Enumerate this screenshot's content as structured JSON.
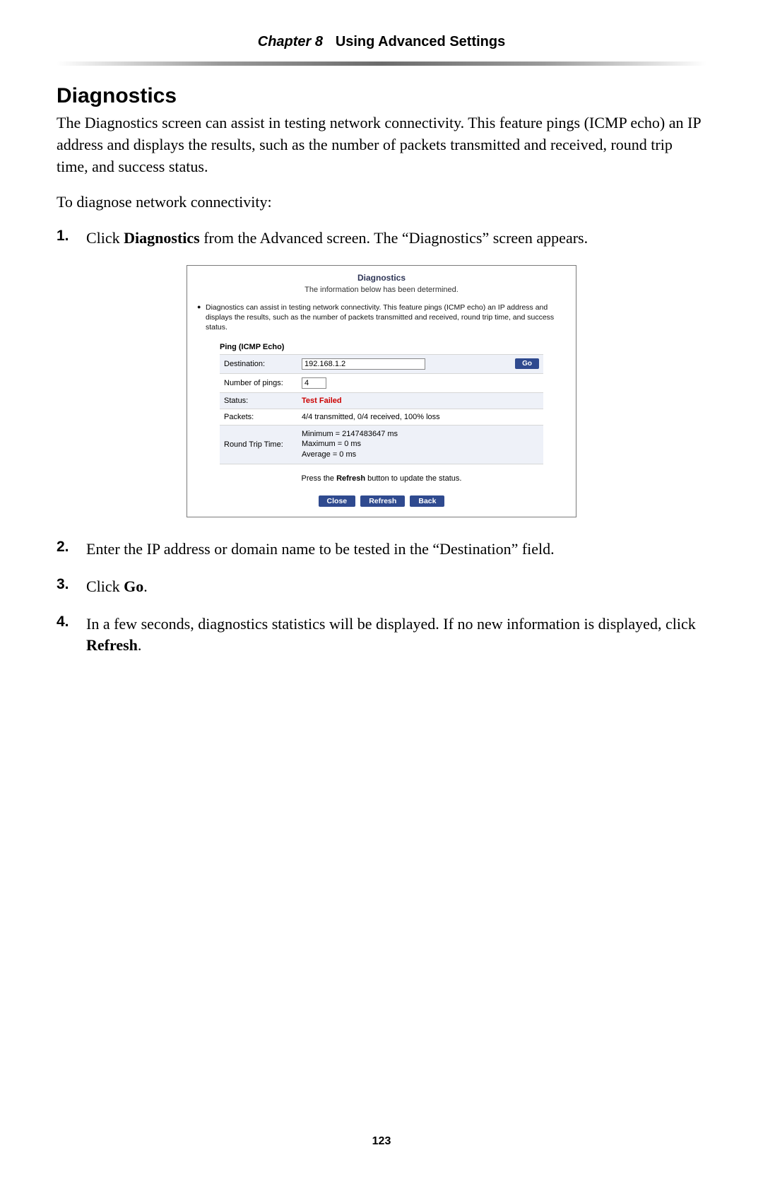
{
  "header": {
    "chapter_label": "Chapter 8",
    "chapter_title": "Using Advanced Settings"
  },
  "section_heading": "Diagnostics",
  "intro_para": "The Diagnostics screen can assist in testing network connectivity. This feature pings (ICMP echo) an IP address and displays the results, such as the number of packets transmitted and received, round trip time, and success status.",
  "lead_in": "To diagnose network connectivity:",
  "steps": {
    "s1": {
      "num": "1.",
      "pre": "Click ",
      "bold": "Diagnostics",
      "post": " from the Advanced screen. The “Diagnostics” screen appears."
    },
    "s2": {
      "num": "2.",
      "text": "Enter the IP address or domain name to be tested in the “Destination” field."
    },
    "s3": {
      "num": "3.",
      "pre": "Click ",
      "bold": "Go",
      "post": "."
    },
    "s4": {
      "num": "4.",
      "pre": "In a few seconds, diagnostics statistics will be displayed. If no new information is displayed, click ",
      "bold": "Refresh",
      "post": "."
    }
  },
  "shot": {
    "title": "Diagnostics",
    "subtitle": "The information below has been determined.",
    "bullet": "Diagnostics can assist in testing network connectivity. This feature pings (ICMP echo) an IP address and displays the results, such as the number of packets transmitted and received, round trip time, and success status.",
    "ping_header": "Ping (ICMP Echo)",
    "rows": {
      "dest_label": "Destination:",
      "dest_value": "192.168.1.2",
      "go_label": "Go",
      "np_label": "Number of pings:",
      "np_value": "4",
      "status_label": "Status:",
      "status_value": "Test Failed",
      "packets_label": "Packets:",
      "packets_value": "4/4 transmitted, 0/4 received, 100% loss",
      "rtt_label": "Round Trip Time:",
      "rtt_min": "Minimum = 2147483647 ms",
      "rtt_max": "Maximum = 0 ms",
      "rtt_avg": "Average = 0 ms"
    },
    "refresh_note_pre": "Press the ",
    "refresh_note_bold": "Refresh",
    "refresh_note_post": " button to update the status.",
    "buttons": {
      "close": "Close",
      "refresh": "Refresh",
      "back": "Back"
    }
  },
  "page_number": "123"
}
